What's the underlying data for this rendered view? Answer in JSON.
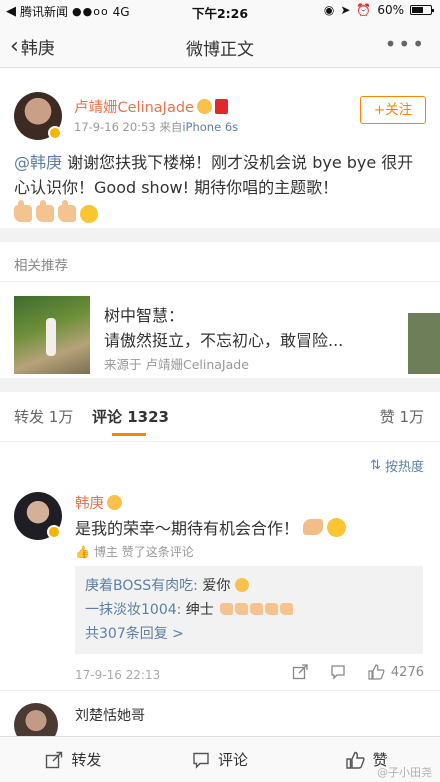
{
  "status_bar": {
    "back_app": "腾讯新闻",
    "signal": "●●oo",
    "network": "4G",
    "time": "下午2:26",
    "battery_text": "60%",
    "battery_level": 0.6
  },
  "nav": {
    "back_label": "韩庚",
    "title": "微博正文",
    "more_label": "•••"
  },
  "post": {
    "author": "卢靖姗CelinaJade",
    "date": "17-9-16 20:53",
    "source_prefix": "来自",
    "source": "iPhone 6s",
    "follow_label": "+关注",
    "mention": "@韩庚",
    "text": " 谢谢您扶我下楼梯！刚才没机会说 bye bye 很开心认识你！Good show! 期待你唱的主题歌！"
  },
  "related": {
    "header": "相关推荐",
    "title": "树中智慧：",
    "subtitle": "请傲然挺立，不忘初心，敢冒险...",
    "source": "来源于 卢靖姗CelinaJade"
  },
  "tabs": {
    "repost": "转发 1万",
    "comment": "评论 1323",
    "like": "赞 1万"
  },
  "sort": {
    "label": "按热度"
  },
  "comment": {
    "author": "韩庚",
    "text": "是我的荣幸～期待有机会合作！",
    "liked_by": "博主 赞了这条评论",
    "replies": [
      {
        "user": "庚着BOSS有肉吃:",
        "text": " 爱你"
      },
      {
        "user": "一抹淡妆1004:",
        "text": " 绅士"
      }
    ],
    "more_replies": "共307条回复 >",
    "date": "17-9-16 22:13",
    "likes": "4276"
  },
  "comment2": {
    "author": "刘楚恬她哥"
  },
  "toolbar": {
    "repost": "转发",
    "comment": "评论",
    "like": "赞"
  },
  "watermark": "@子小田尧",
  "colors": {
    "accent_orange": "#ff8200",
    "name_orange": "#eb7350",
    "link_blue": "#5d7fa6"
  }
}
